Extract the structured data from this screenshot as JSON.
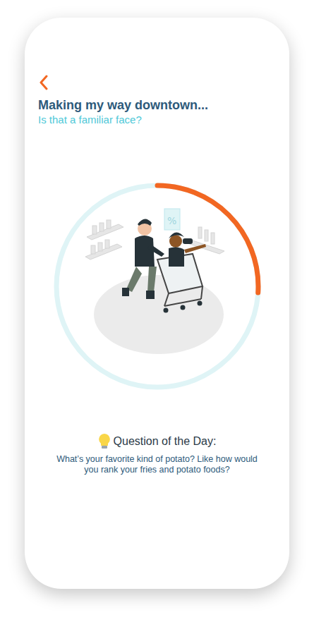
{
  "header": {
    "title": "Making my way downtown...",
    "subtitle": "Is that a familiar face?"
  },
  "progress": {
    "level": 0.26
  },
  "question": {
    "heading": "Question of the Day:",
    "text": "What’s your favorite kind of potato? Like how would you rank your fries and potato foods?"
  }
}
